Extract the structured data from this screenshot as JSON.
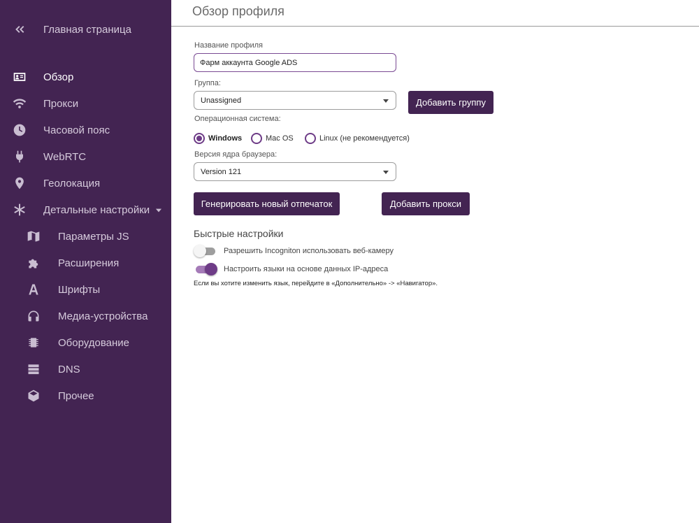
{
  "sidebar": {
    "home_label": "Главная страница",
    "items": [
      {
        "label": "Обзор",
        "icon": "id-card-icon",
        "active": true
      },
      {
        "label": "Прокси",
        "icon": "wifi-icon"
      },
      {
        "label": "Часовой пояс",
        "icon": "clock-icon"
      },
      {
        "label": "WebRTC",
        "icon": "plug-icon"
      },
      {
        "label": "Геолокация",
        "icon": "map-pin-icon"
      },
      {
        "label": "Детальные настройки",
        "icon": "asterisk-icon"
      }
    ],
    "sub_items": [
      {
        "label": "Параметры JS",
        "icon": "map-icon"
      },
      {
        "label": "Расширения",
        "icon": "puzzle-icon"
      },
      {
        "label": "Шрифты",
        "icon": "font-icon"
      },
      {
        "label": "Медиа-устройства",
        "icon": "headphones-icon"
      },
      {
        "label": "Оборудование",
        "icon": "chip-icon"
      },
      {
        "label": "DNS",
        "icon": "server-icon"
      },
      {
        "label": "Прочее",
        "icon": "cube-icon"
      }
    ]
  },
  "page": {
    "title": "Обзор профиля"
  },
  "form": {
    "profile_name_label": "Название профиля",
    "profile_name_value": "Фарм аккаунта Google ADS",
    "group_label": "Группа:",
    "group_value": "Unassigned",
    "add_group_button": "Добавить группу",
    "os_label": "Операционная система:",
    "os_options": [
      "Windows",
      "Mac OS",
      "Linux (не рекомендуется)"
    ],
    "os_selected": "Windows",
    "browser_version_label": "Версия ядра браузера:",
    "browser_version_value": "Version 121",
    "generate_button": "Генерировать новый отпечаток",
    "add_proxy_button": "Добавить прокси"
  },
  "quick_settings": {
    "title": "Быстрые настройки",
    "webcam_toggle_label": "Разрешить Incogniton использовать веб-камеру",
    "webcam_toggle_on": false,
    "language_toggle_label": "Настроить языки на основе данных IP-адреса",
    "language_toggle_on": true,
    "hint": "Если вы хотите изменить язык, перейдите в «Дополнительно» -> «Навигатор»."
  },
  "colors": {
    "sidebar_bg": "#432452",
    "accent": "#6e3c87",
    "button_bg": "#432452"
  }
}
